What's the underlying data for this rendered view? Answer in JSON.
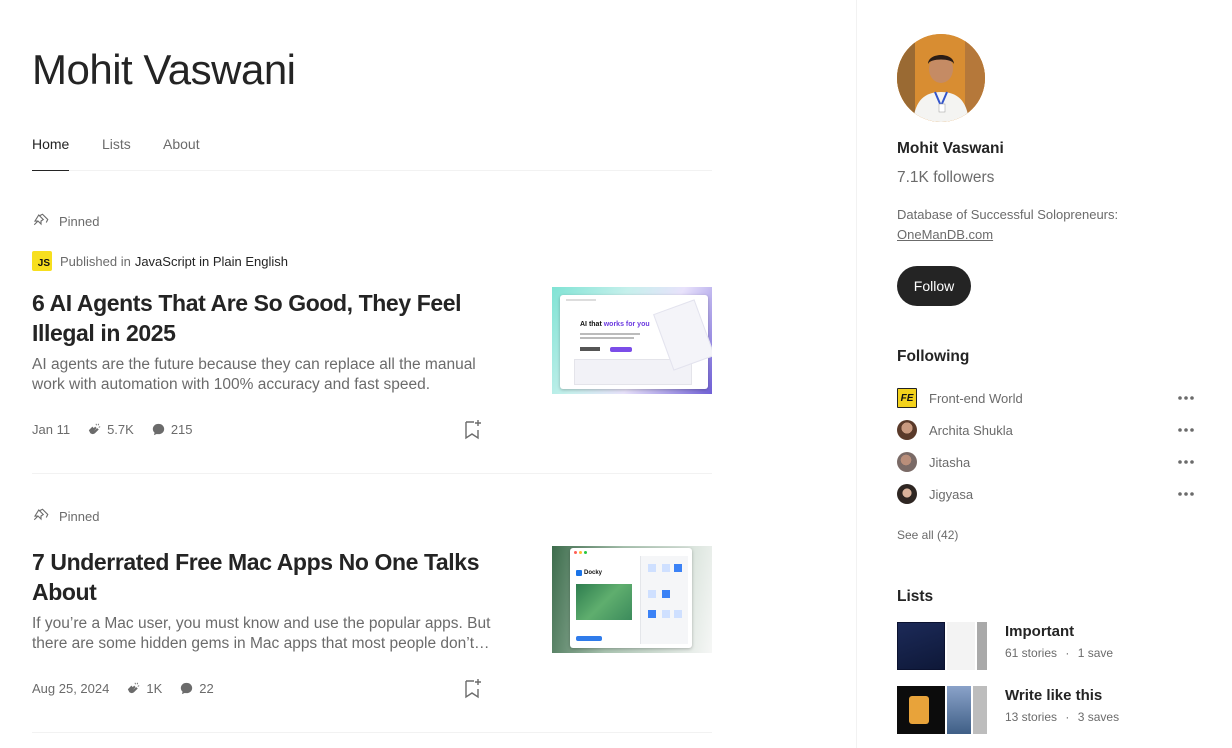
{
  "author": {
    "name": "Mohit Vaswani"
  },
  "tabs": [
    {
      "label": "Home",
      "active": true
    },
    {
      "label": "Lists",
      "active": false
    },
    {
      "label": "About",
      "active": false
    }
  ],
  "posts": [
    {
      "pinned_label": "Pinned",
      "published_prefix": "Published in",
      "publication": "JavaScript in Plain English",
      "publication_badge": "JS",
      "title": "6 AI Agents That Are So Good, They Feel Illegal in 2025",
      "subtitle": "AI agents are the future because they can replace all the manual work with automation with 100% accuracy and fast speed.",
      "date": "Jan 11",
      "claps": "5.7K",
      "responses": "215",
      "thumb_headline_a": "AI that ",
      "thumb_headline_b": "works for you"
    },
    {
      "pinned_label": "Pinned",
      "title": "7 Underrated Free Mac Apps No One Talks About",
      "subtitle": "If you’re a Mac user, you must know and use the popular apps. But there are some hidden gems in Mac apps that most people don’t know about.",
      "date": "Aug 25, 2024",
      "claps": "1K",
      "responses": "22",
      "thumb_app_name": "Docky"
    }
  ],
  "sidebar": {
    "name": "Mohit Vaswani",
    "followers": "7.1K followers",
    "bio_text": "Database of Successful Solopreneurs:",
    "bio_link": "OneManDB.com",
    "follow_label": "Follow",
    "following_heading": "Following",
    "following": [
      {
        "name": "Front-end World",
        "badge": "FE"
      },
      {
        "name": "Archita Shukla"
      },
      {
        "name": "Jitasha"
      },
      {
        "name": "Jigyasa"
      }
    ],
    "see_all": "See all (42)",
    "lists_heading": "Lists",
    "lists": [
      {
        "title": "Important",
        "stories": "61 stories",
        "sep": "·",
        "saves": "1 save"
      },
      {
        "title": "Write like this",
        "stories": "13 stories",
        "sep": "·",
        "saves": "3 saves"
      }
    ]
  },
  "colors": {
    "text_primary": "#242424",
    "text_secondary": "#6b6b6b",
    "divider": "#f2f2f2",
    "js_yellow": "#f7df1e",
    "button_dark": "#242424"
  },
  "icons": [
    "pin-icon",
    "clap-icon",
    "response-icon",
    "bookmark-add-icon",
    "more-icon"
  ]
}
